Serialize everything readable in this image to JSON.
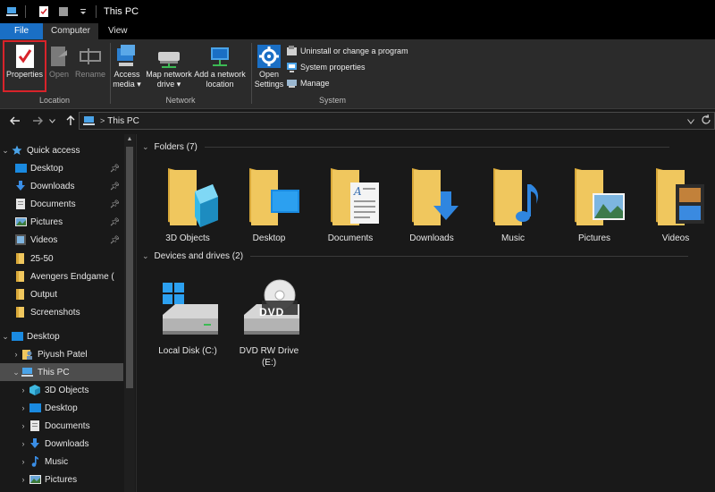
{
  "window": {
    "title": "This PC"
  },
  "tabs": {
    "file": "File",
    "computer": "Computer",
    "view": "View"
  },
  "ribbon": {
    "location": {
      "label": "Location",
      "properties": "Properties",
      "open": "Open",
      "rename": "Rename"
    },
    "network": {
      "label": "Network",
      "access_media_1": "Access",
      "access_media_2": "media",
      "map_drive_1": "Map network",
      "map_drive_2": "drive",
      "add_location_1": "Add a network",
      "add_location_2": "location"
    },
    "system": {
      "label": "System",
      "open_settings_1": "Open",
      "open_settings_2": "Settings",
      "uninstall": "Uninstall or change a program",
      "system_properties": "System properties",
      "manage": "Manage"
    }
  },
  "address": {
    "path": "This PC"
  },
  "nav": {
    "quick_access": "Quick access",
    "qa_desktop": "Desktop",
    "qa_downloads": "Downloads",
    "qa_documents": "Documents",
    "qa_pictures": "Pictures",
    "qa_videos": "Videos",
    "qa_25_50": "25-50",
    "qa_avengers": "Avengers Endgame (",
    "qa_output": "Output",
    "qa_screenshots": "Screenshots",
    "desktop": "Desktop",
    "user": "Piyush Patel",
    "this_pc": "This PC",
    "pc_3d": "3D Objects",
    "pc_desktop": "Desktop",
    "pc_documents": "Documents",
    "pc_downloads": "Downloads",
    "pc_music": "Music",
    "pc_pictures": "Pictures"
  },
  "content": {
    "folders_header": "Folders (7)",
    "devices_header": "Devices and drives (2)",
    "folders": [
      "3D Objects",
      "Desktop",
      "Documents",
      "Downloads",
      "Music",
      "Pictures",
      "Videos"
    ],
    "drive_c": "Local Disk (C:)",
    "drive_e_1": "DVD RW Drive",
    "drive_e_2": "(E:)",
    "dvd_text": "DVD"
  },
  "colors": {
    "accent": "#1a6fc5",
    "highlight_box": "#d8232a",
    "folder": "#f0c75e",
    "selected_row": "#4d4d4d"
  }
}
